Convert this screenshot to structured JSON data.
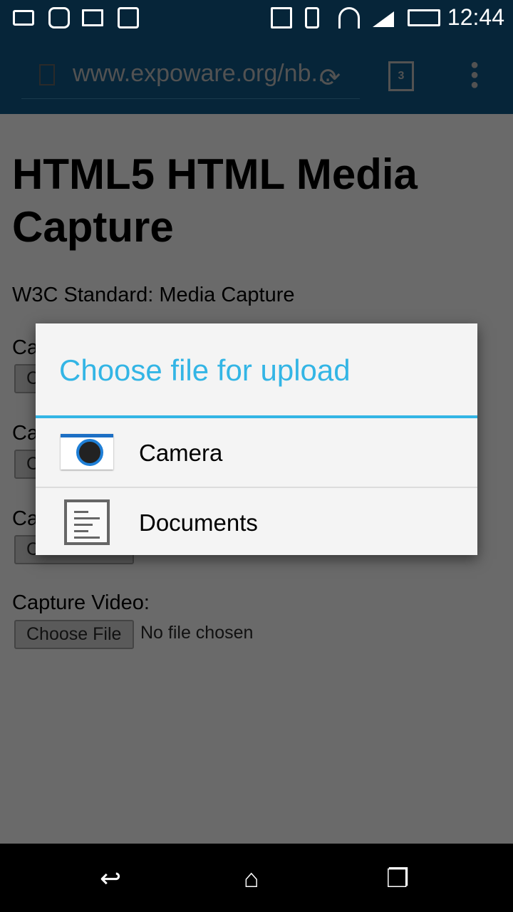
{
  "status_bar": {
    "time": "12:44",
    "icons": [
      "battery-saver-icon",
      "instagram-icon",
      "gallery-icon",
      "shopping-check-icon",
      "nfc-icon",
      "vibrate-icon",
      "wifi-icon",
      "signal-icon",
      "battery-icon"
    ]
  },
  "browser": {
    "url": "www.expoware.org/nb...",
    "tab_count": "3"
  },
  "page": {
    "title": "HTML5 HTML Media Capture",
    "subtitle": "W3C Standard: Media Capture",
    "partial_labels": [
      "Ca",
      "Ca",
      "Ca"
    ],
    "partial_buttons": [
      "C",
      "C",
      "C"
    ],
    "video_label": "Capture Video:",
    "choose_file": "Choose File",
    "no_file": "No file chosen"
  },
  "dialog": {
    "title": "Choose file for upload",
    "accent": "#33b5e5",
    "options": [
      {
        "label": "Camera",
        "icon": "camera-icon"
      },
      {
        "label": "Documents",
        "icon": "document-icon"
      }
    ]
  }
}
